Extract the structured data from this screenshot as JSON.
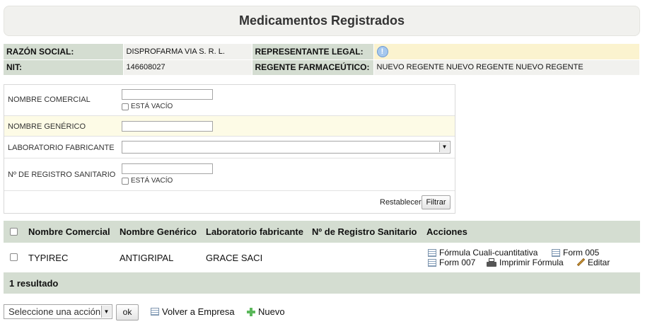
{
  "header": {
    "title": "Medicamentos Registrados"
  },
  "company": {
    "razon_label": "RAZÓN SOCIAL:",
    "razon_value": "DISPROFARMA VIA S. R. L.",
    "rep_label": "REPRESENTANTE LEGAL:",
    "rep_icon": "info-icon",
    "nit_label": "NIT:",
    "nit_value": "146608027",
    "regente_label": "REGENTE FARMACEÚTICO:",
    "regente_value": "NUEVO REGENTE NUEVO REGENTE NUEVO REGENTE"
  },
  "filters": {
    "nombre_comercial": {
      "label": "NOMBRE COMERCIAL",
      "value": "",
      "empty_label": "ESTÁ VACÍO"
    },
    "nombre_generico": {
      "label": "NOMBRE GENÉRICO",
      "value": ""
    },
    "laboratorio": {
      "label": "LABORATORIO FABRICANTE",
      "value": ""
    },
    "registro": {
      "label": "Nº DE REGISTRO SANITARIO",
      "value": "",
      "empty_label": "ESTÁ VACÍO"
    },
    "reset_label": "Restablecer",
    "filter_label": "Filtrar"
  },
  "results": {
    "columns": [
      "Nombre Comercial",
      "Nombre Genérico",
      "Laboratorio fabricante",
      "Nº de Registro Sanitario",
      "Acciones"
    ],
    "rows": [
      {
        "nombre_comercial": "TYPIREC",
        "nombre_generico": "ANTIGRIPAL",
        "laboratorio": "GRACE SACI",
        "registro": "",
        "actions": [
          "Fórmula Cuali-cuantitativa",
          "Form 005",
          "Form 007",
          "Imprimir Fórmula",
          "Editar"
        ]
      }
    ],
    "count_label": "1 resultado"
  },
  "bottom": {
    "action_select": "Seleccione una acción",
    "ok_label": "ok",
    "back_label": "Volver a Empresa",
    "new_label": "Nuevo"
  },
  "colors": {
    "header_bg": "#d4ddd1",
    "highlight": "#fbf3cf",
    "panel_bg": "#f1f1ee"
  }
}
